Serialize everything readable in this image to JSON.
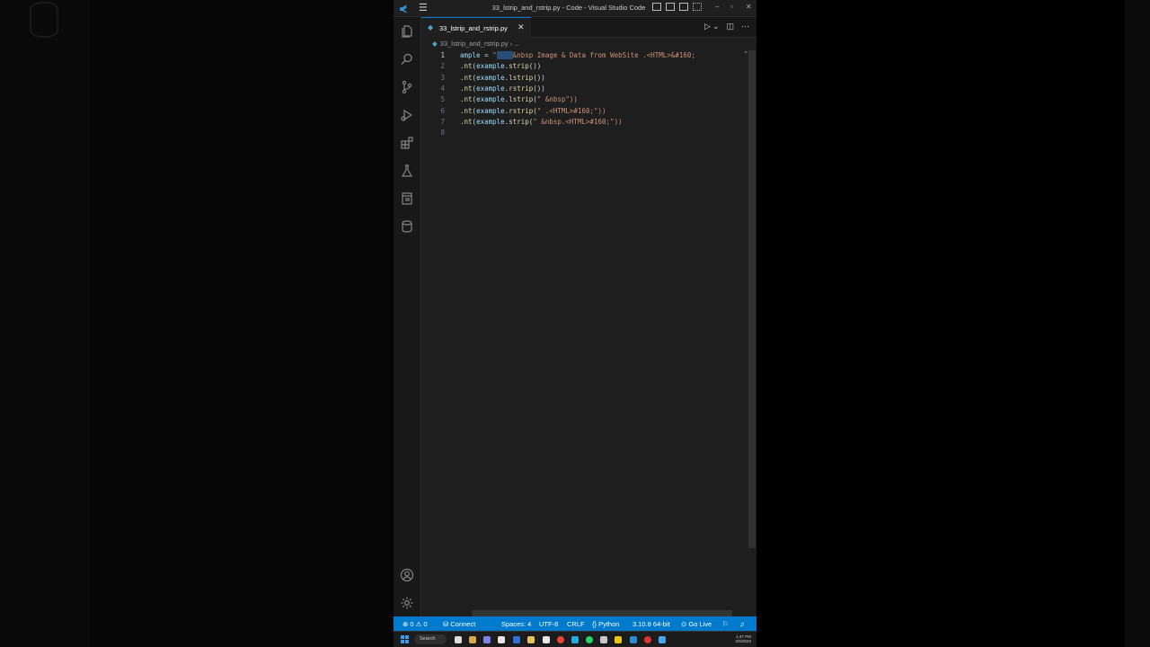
{
  "window": {
    "title": "33_lstrip_and_rstrip.py - Code - Visual Studio Code"
  },
  "tab": {
    "label": "33_lstrip_and_rstrip.py",
    "close": "✕"
  },
  "breadcrumb": {
    "file": "33_lstrip_and_rstrip.py",
    "rest": "› ..."
  },
  "editor": {
    "line_numbers": [
      "1",
      "2",
      "3",
      "4",
      "5",
      "6",
      "7",
      "8"
    ],
    "lines": [
      "ample = \"    &nbsp Image & Data from WebSite .<HTML>&#160;",
      ".nt(example.strip())",
      ".nt(example.lstrip())",
      ".nt(example.rstrip())",
      ".nt(example.lstrip(\" &nbsp\"))",
      ".nt(example.rstrip(\" .<HTML>#160;\"))",
      ".nt(example.strip(\" &nbsp.<HTML>#160;\"))",
      ""
    ],
    "overflow_quote": "\""
  },
  "status": {
    "problems": "⊗ 0 ⚠ 0",
    "connect": "Connect",
    "spaces": "Spaces: 4",
    "encoding": "UTF-8",
    "eol": "CRLF",
    "language": "Python",
    "interpreter": "3.10.8 64-bit",
    "golive": "Go Live"
  },
  "taskbar": {
    "search": "Search",
    "time": "1:47 PM",
    "date": "2/5/2023"
  },
  "colors": {
    "accent": "#007acc",
    "string": "#ce9178",
    "function": "#dcdcaa",
    "variable": "#9cdcfe"
  }
}
